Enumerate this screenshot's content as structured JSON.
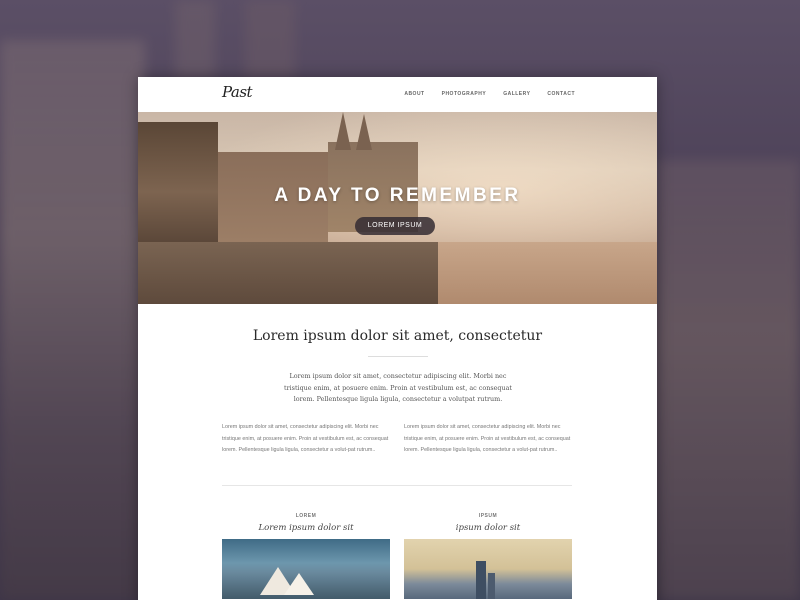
{
  "brand": {
    "logo": "Past"
  },
  "nav": {
    "items": [
      "ABOUT",
      "PHOTOGRAPHY",
      "GALLERY",
      "CONTACT"
    ]
  },
  "hero": {
    "title": "A DAY TO REMEMBER",
    "button": "LOREM IPSUM"
  },
  "intro_section": {
    "heading": "Lorem ipsum dolor sit amet, consectetur",
    "paragraph": "Lorem ipsum dolor sit amet, consectetur adipiscing elit. Morbi nec tristique enim, at posuere enim. Proin at vestibulum est, ac consequat lorem. Pellentesque ligula ligula, consectetur a volutpat rutrum."
  },
  "columns": {
    "left": "Lorem ipsum dolor sit amet, consectetur adipiscing elit. Morbi nec tristique enim, at posuere enim. Proin at vestibulum est, ac consequat lorem. Pellentesque ligula ligula, consectetur a volut-pat rutrum..",
    "right": "Lorem ipsum dolor sit amet, consectetur adipiscing elit. Morbi nec tristique enim, at posuere enim. Proin at vestibulum est, ac consequat lorem. Pellentesque ligula ligula, consectetur a volut-pat rutrum.."
  },
  "cards": [
    {
      "label": "LOREM",
      "title": "Lorem ipsum dolor sit",
      "image": "sydney-opera-house-photo"
    },
    {
      "label": "IPSUM",
      "title": "ipsum dolor sit",
      "image": "city-skyline-photo"
    }
  ]
}
